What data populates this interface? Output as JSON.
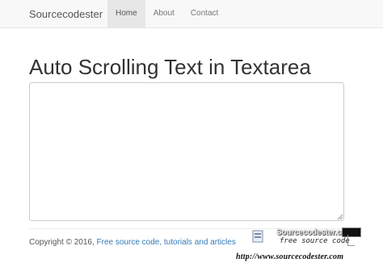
{
  "navbar": {
    "brand": "Sourcecodester",
    "items": [
      {
        "label": "Home",
        "active": true
      },
      {
        "label": "About",
        "active": false
      },
      {
        "label": "Contact",
        "active": false
      }
    ]
  },
  "main": {
    "title": "Auto Scrolling Text in Textarea",
    "textarea_value": ""
  },
  "footer": {
    "copyright": "Copyright © 2016, ",
    "link_text": "Free source code, tutorials and articles"
  },
  "watermark": {
    "brand": "Sourcecodester.com",
    "subtitle": "free source code",
    "url": "http://www.sourcecodester.com"
  }
}
